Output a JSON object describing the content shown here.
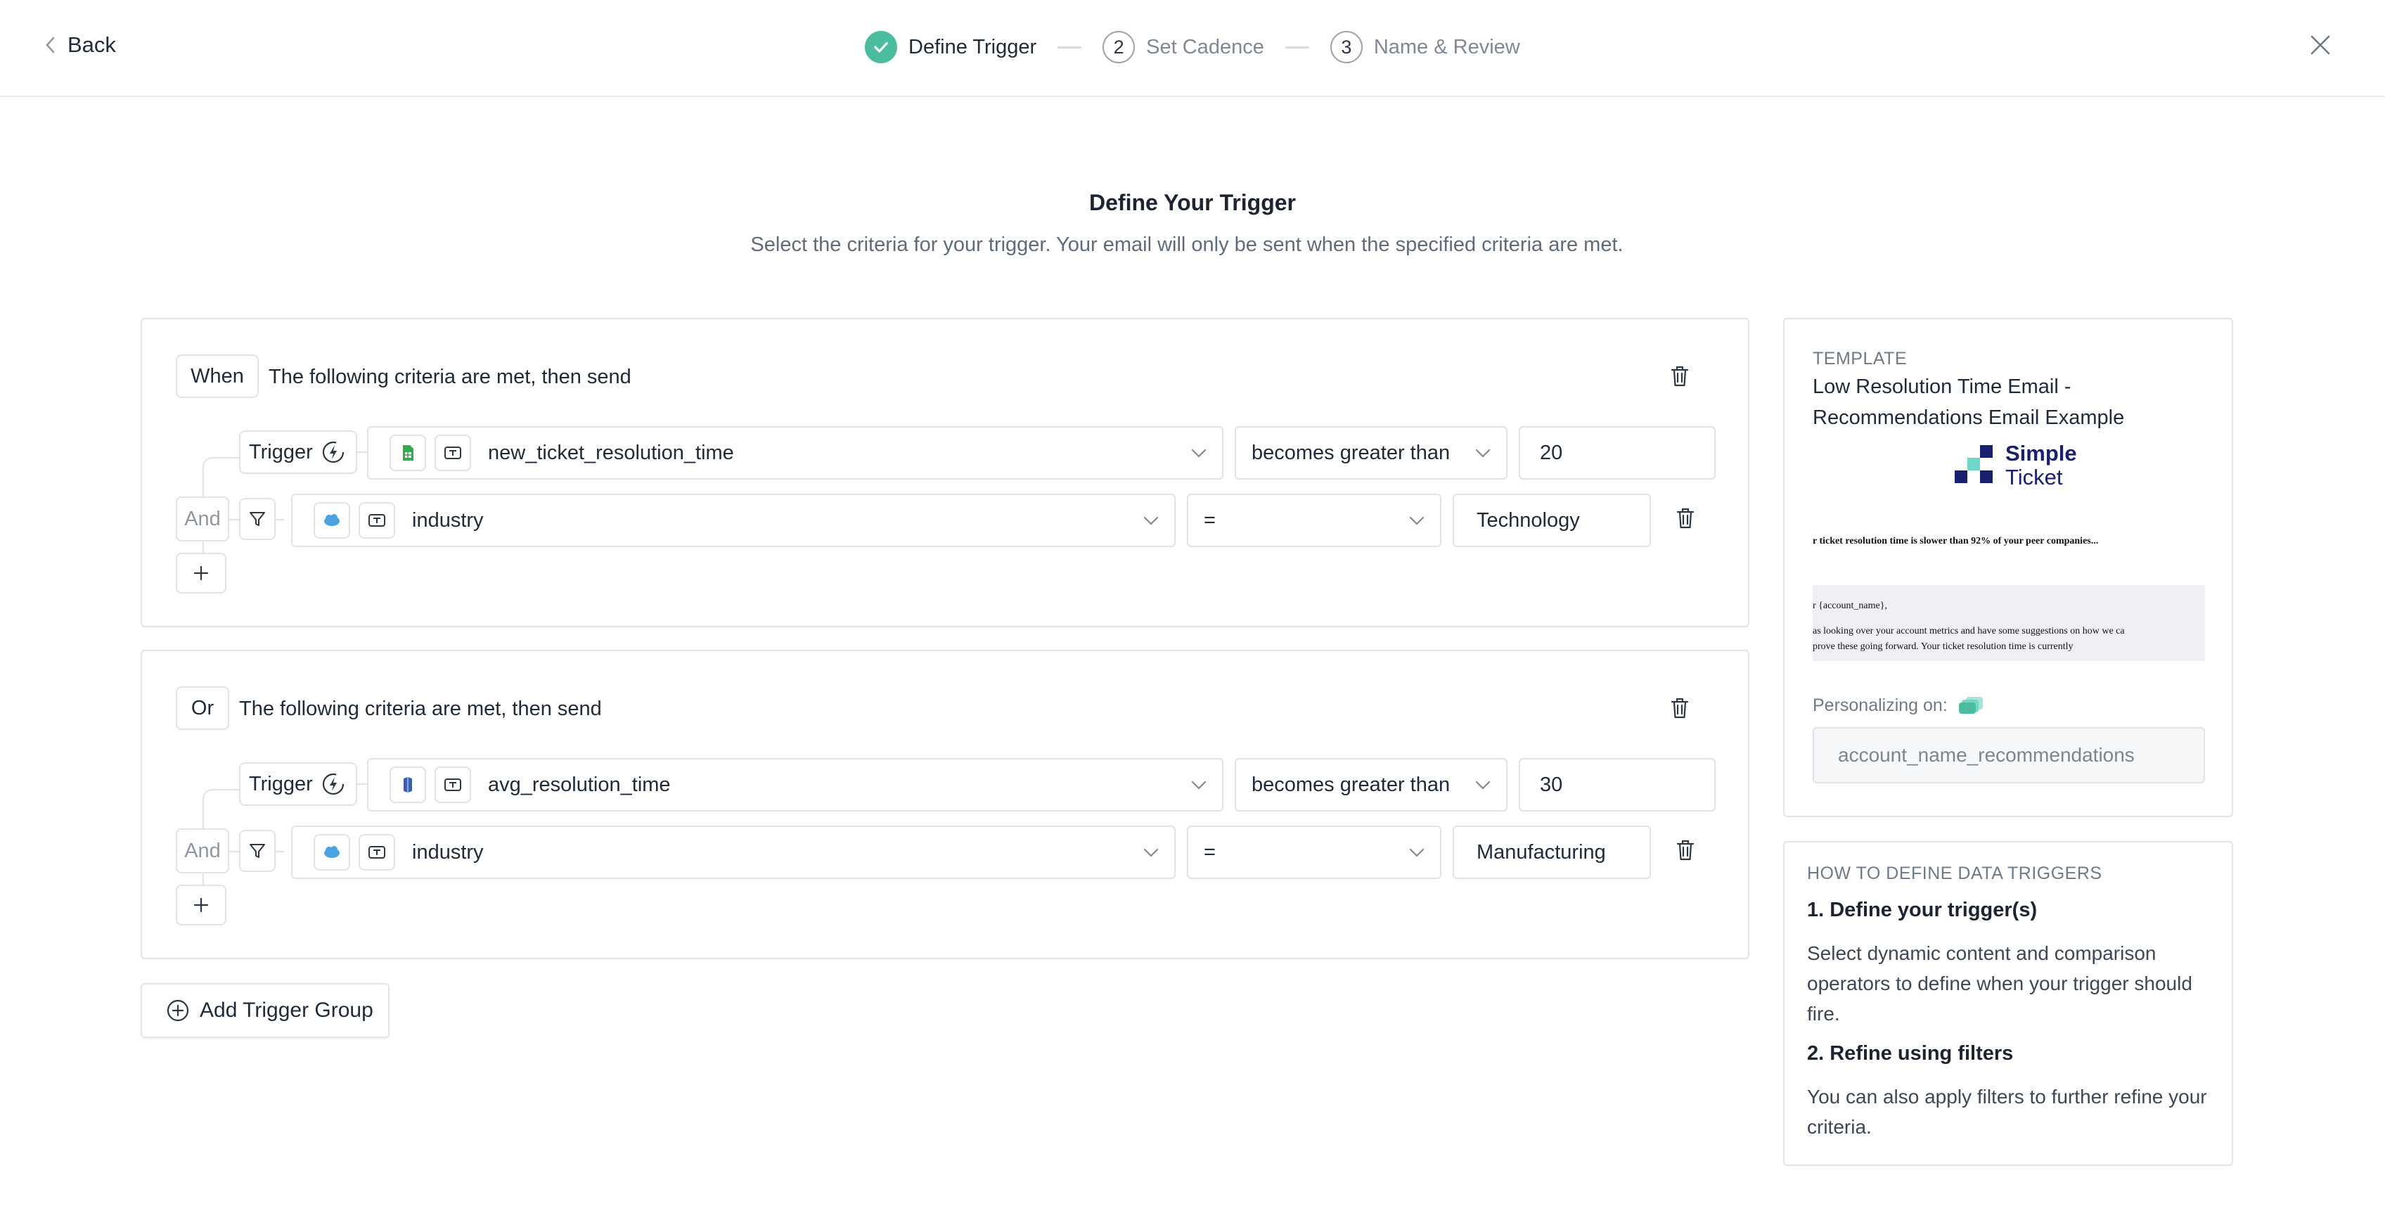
{
  "header": {
    "back_label": "Back",
    "steps": [
      {
        "number": "",
        "label": "Define Trigger"
      },
      {
        "number": "2",
        "label": "Set Cadence"
      },
      {
        "number": "3",
        "label": "Name & Review"
      }
    ]
  },
  "page": {
    "title": "Define Your Trigger",
    "subtitle": "Select the criteria for your trigger. Your email will only be sent when the specified criteria are met."
  },
  "groups": [
    {
      "connector": "When",
      "text": "The following criteria are met, then send",
      "trigger_label": "Trigger",
      "trigger_field": "new_ticket_resolution_time",
      "trigger_operator": "becomes greater than",
      "trigger_value": "20",
      "filter_connector": "And",
      "filter_field": "industry",
      "filter_operator": "=",
      "filter_value": "Technology"
    },
    {
      "connector": "Or",
      "text": "The following criteria are met, then send",
      "trigger_label": "Trigger",
      "trigger_field": "avg_resolution_time",
      "trigger_operator": "becomes greater than",
      "trigger_value": "30",
      "filter_connector": "And",
      "filter_field": "industry",
      "filter_operator": "=",
      "filter_value": "Manufacturing"
    }
  ],
  "add_group_label": "Add Trigger Group",
  "template": {
    "caption": "TEMPLATE",
    "name": "Low Resolution Time Email - Recommendations Email Example",
    "logo_line1": "Simple",
    "logo_line2": "Ticket",
    "preview_headline": "r ticket resolution time is slower than 92% of your peer companies...",
    "preview_greeting": "r {account_name},",
    "preview_body1": "as looking over your account metrics and have some suggestions on how we ca",
    "preview_body2": "prove these going forward. Your ticket resolution time is currently",
    "personalizing_label": "Personalizing on:",
    "personalizing_value": "account_name_recommendations"
  },
  "help": {
    "caption": "HOW TO DEFINE DATA TRIGGERS",
    "step1_title": "1. Define your trigger(s)",
    "step1_body": "Select dynamic content and comparison operators to define when your trigger should fire.",
    "step2_title": "2. Refine using filters",
    "step2_body": "You can also apply filters to further refine your criteria."
  },
  "colors": {
    "accent_green": "#4bbd9e",
    "border": "#dfe3e8",
    "salesforce_blue": "#4aa3e0",
    "sheets_green": "#34a853",
    "logo_navy": "#1a2070",
    "logo_teal": "#6fd6c8"
  }
}
